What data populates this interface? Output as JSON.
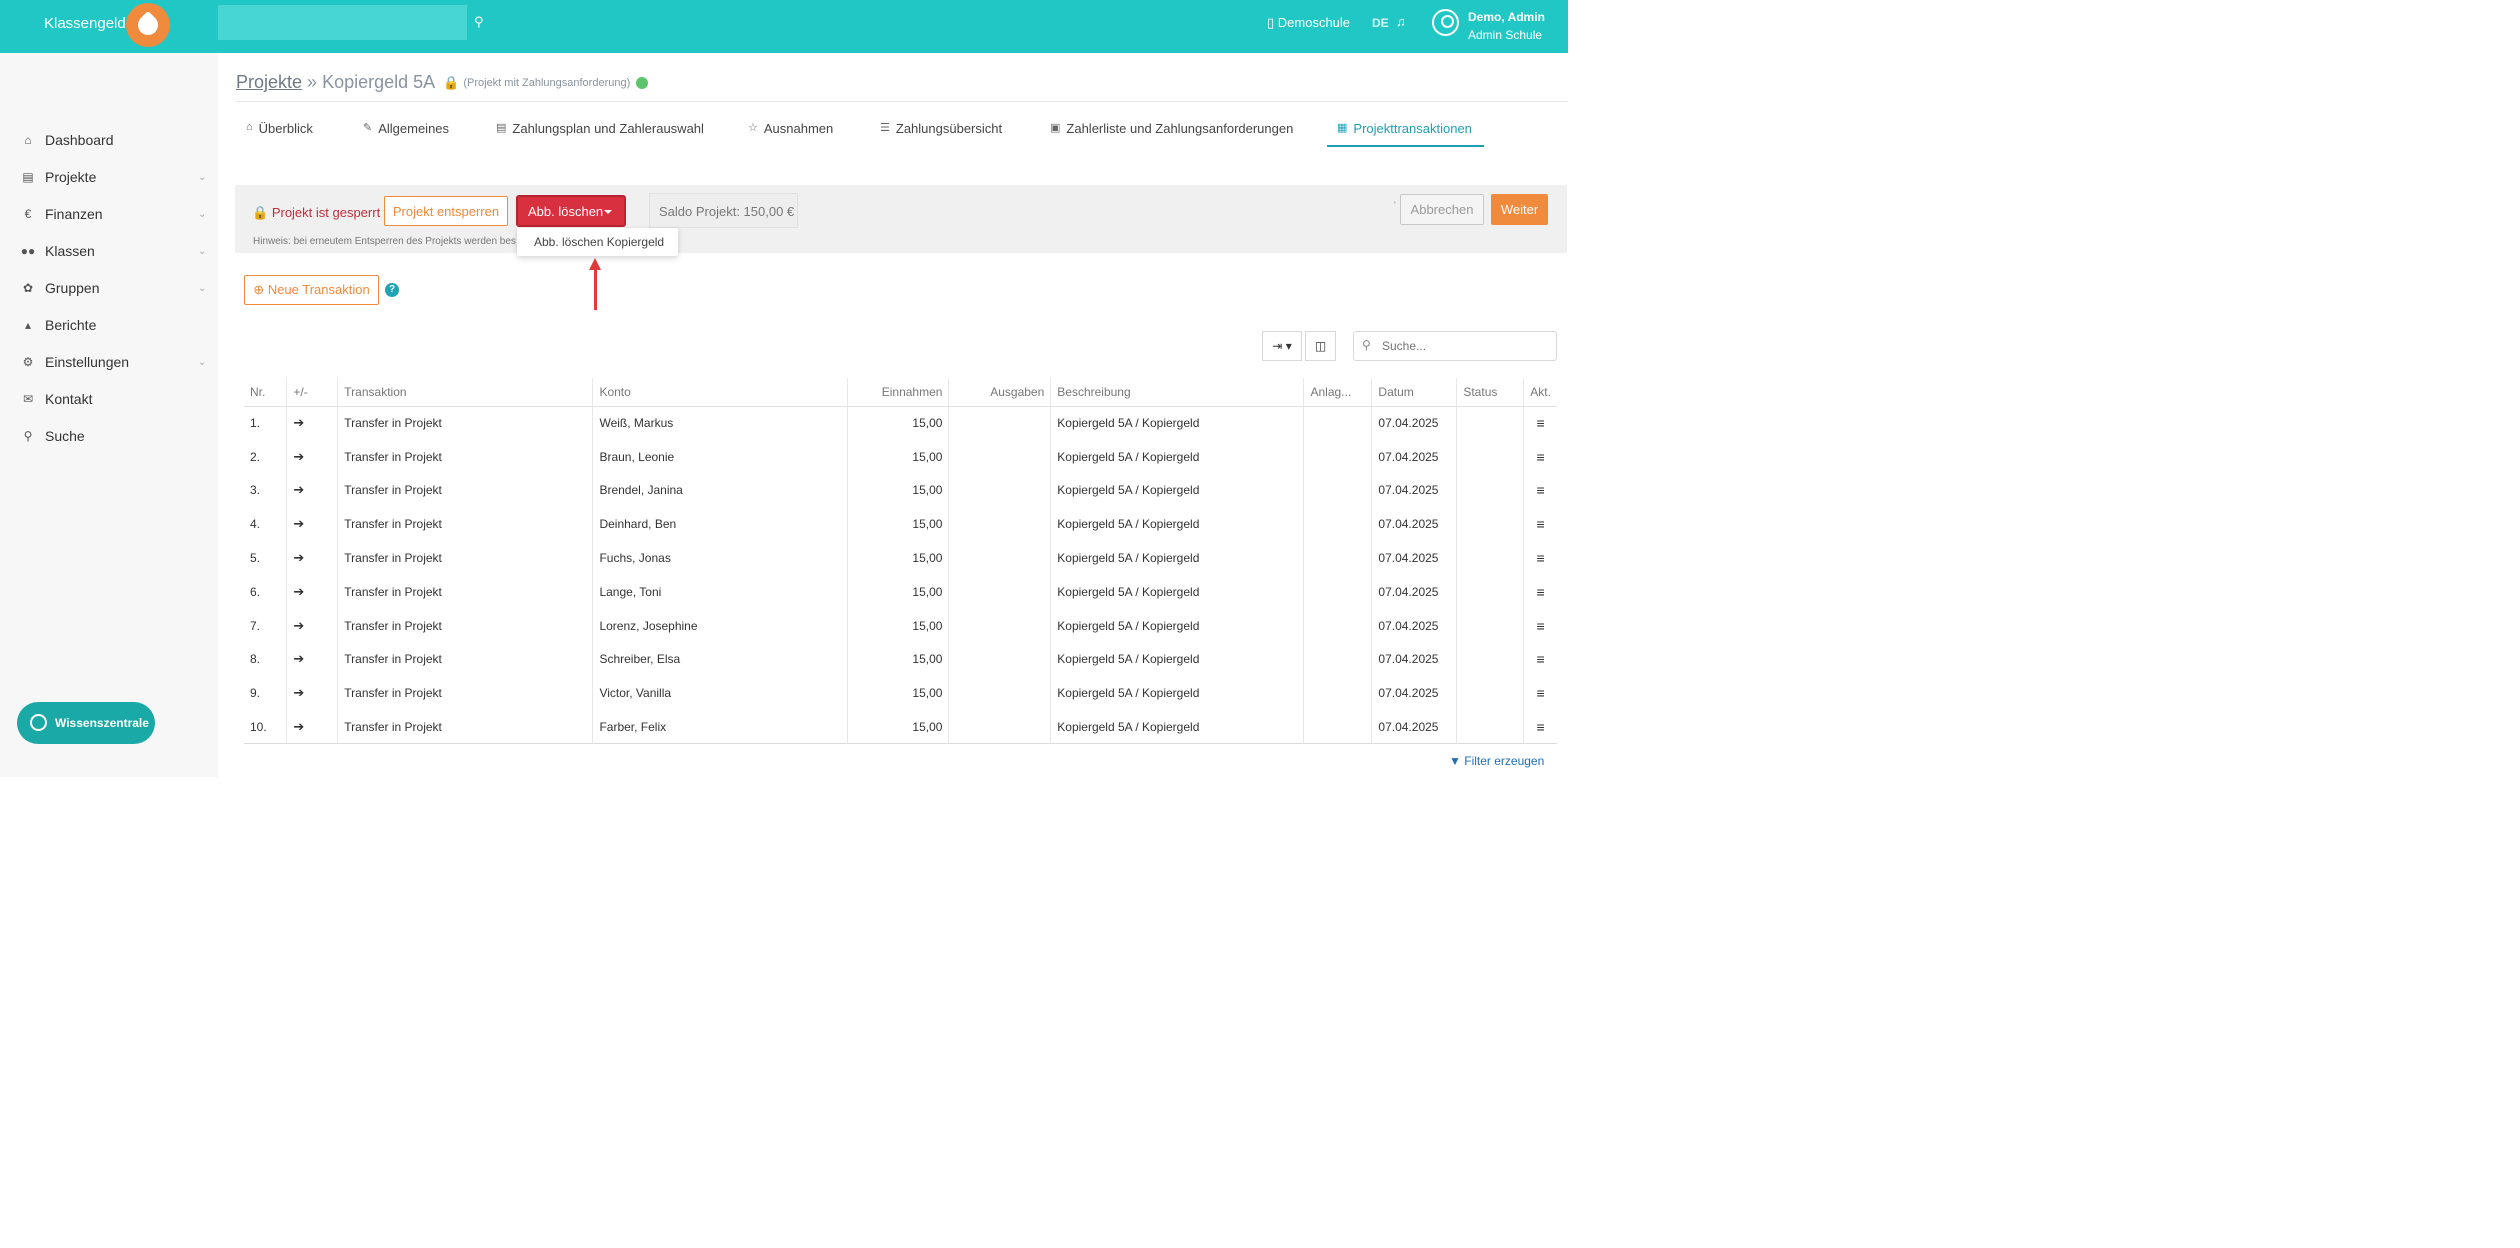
{
  "header": {
    "brand": "Klassengeld",
    "school_label": "Demoschule",
    "lang": "DE",
    "user_name": "Demo, Admin",
    "user_school": "Admin Schule",
    "accent": "#21c7c4"
  },
  "sidebar": {
    "items": [
      {
        "label": "Dashboard",
        "icon": "home-icon"
      },
      {
        "label": "Projekte",
        "icon": "card-icon"
      },
      {
        "label": "Finanzen",
        "icon": "euro-icon"
      },
      {
        "label": "Klassen",
        "icon": "users-icon"
      },
      {
        "label": "Gruppen",
        "icon": "leaf-icon"
      },
      {
        "label": "Berichte",
        "icon": "chart-icon"
      },
      {
        "label": "Einstellungen",
        "icon": "gear-icon"
      },
      {
        "label": "Kontakt",
        "icon": "envelope-icon"
      },
      {
        "label": "Suche",
        "icon": "search-icon"
      }
    ],
    "wissen_label": "Wissenszentrale"
  },
  "page": {
    "breadcrumb_link": "Projekte",
    "breadcrumb_sep": " » ",
    "title": "Kopiergeld 5A",
    "title_note": "(Projekt mit Zahlungsanforderung)",
    "tabs": [
      {
        "label": "Überblick",
        "icon": "home-icon"
      },
      {
        "label": "Allgemeines",
        "icon": "pencil-icon"
      },
      {
        "label": "Zahlungsplan und Zahlerauswahl",
        "icon": "card-icon"
      },
      {
        "label": "Ausnahmen",
        "icon": "star-icon"
      },
      {
        "label": "Zahlungsübersicht",
        "icon": "list-icon"
      },
      {
        "label": "Zahlerliste und Zahlungsanforderungen",
        "icon": "box-icon"
      },
      {
        "label": "Projekttransaktionen",
        "icon": "table-icon"
      }
    ]
  },
  "lockbar": {
    "status": "Projekt ist gesperrt",
    "unlock_label": "Projekt entsperren",
    "delete_label": "Abb. löschen",
    "dropdown_item": "Abb. löschen Kopiergeld",
    "saldo": "Saldo Projekt: 150,00 €",
    "hint": "Hinweis: bei erneutem Entsperren des Projekts werden bes",
    "cancel_label": "Abbrechen",
    "next_label": "Weiter"
  },
  "toolbar": {
    "new_label": "Neue Transaktion",
    "search_placeholder": "Suche..."
  },
  "table": {
    "headers": [
      "Nr.",
      "+/-",
      "Transaktion",
      "Konto",
      "Einnahmen",
      "Ausgaben",
      "Beschreibung",
      "Anlag...",
      "Datum",
      "Status",
      "Akt."
    ],
    "rows": [
      {
        "nr": "1.",
        "tx": "Transfer in Projekt",
        "konto": "Weiß, Markus",
        "ein": "15,00",
        "aus": "",
        "desc": "Kopiergeld 5A / Kopiergeld",
        "anl": "",
        "datum": "07.04.2025",
        "status": ""
      },
      {
        "nr": "2.",
        "tx": "Transfer in Projekt",
        "konto": "Braun, Leonie",
        "ein": "15,00",
        "aus": "",
        "desc": "Kopiergeld 5A / Kopiergeld",
        "anl": "",
        "datum": "07.04.2025",
        "status": ""
      },
      {
        "nr": "3.",
        "tx": "Transfer in Projekt",
        "konto": "Brendel, Janina",
        "ein": "15,00",
        "aus": "",
        "desc": "Kopiergeld 5A / Kopiergeld",
        "anl": "",
        "datum": "07.04.2025",
        "status": ""
      },
      {
        "nr": "4.",
        "tx": "Transfer in Projekt",
        "konto": "Deinhard, Ben",
        "ein": "15,00",
        "aus": "",
        "desc": "Kopiergeld 5A / Kopiergeld",
        "anl": "",
        "datum": "07.04.2025",
        "status": ""
      },
      {
        "nr": "5.",
        "tx": "Transfer in Projekt",
        "konto": "Fuchs, Jonas",
        "ein": "15,00",
        "aus": "",
        "desc": "Kopiergeld 5A / Kopiergeld",
        "anl": "",
        "datum": "07.04.2025",
        "status": ""
      },
      {
        "nr": "6.",
        "tx": "Transfer in Projekt",
        "konto": "Lange, Toni",
        "ein": "15,00",
        "aus": "",
        "desc": "Kopiergeld 5A / Kopiergeld",
        "anl": "",
        "datum": "07.04.2025",
        "status": ""
      },
      {
        "nr": "7.",
        "tx": "Transfer in Projekt",
        "konto": "Lorenz, Josephine",
        "ein": "15,00",
        "aus": "",
        "desc": "Kopiergeld 5A / Kopiergeld",
        "anl": "",
        "datum": "07.04.2025",
        "status": ""
      },
      {
        "nr": "8.",
        "tx": "Transfer in Projekt",
        "konto": "Schreiber, Elsa",
        "ein": "15,00",
        "aus": "",
        "desc": "Kopiergeld 5A / Kopiergeld",
        "anl": "",
        "datum": "07.04.2025",
        "status": ""
      },
      {
        "nr": "9.",
        "tx": "Transfer in Projekt",
        "konto": "Victor, Vanilla",
        "ein": "15,00",
        "aus": "",
        "desc": "Kopiergeld 5A / Kopiergeld",
        "anl": "",
        "datum": "07.04.2025",
        "status": ""
      },
      {
        "nr": "10.",
        "tx": "Transfer in Projekt",
        "konto": "Farber, Felix",
        "ein": "15,00",
        "aus": "",
        "desc": "Kopiergeld 5A / Kopiergeld",
        "anl": "",
        "datum": "07.04.2025",
        "status": ""
      }
    ]
  },
  "footer": {
    "filter_label": "Filter erzeugen"
  }
}
